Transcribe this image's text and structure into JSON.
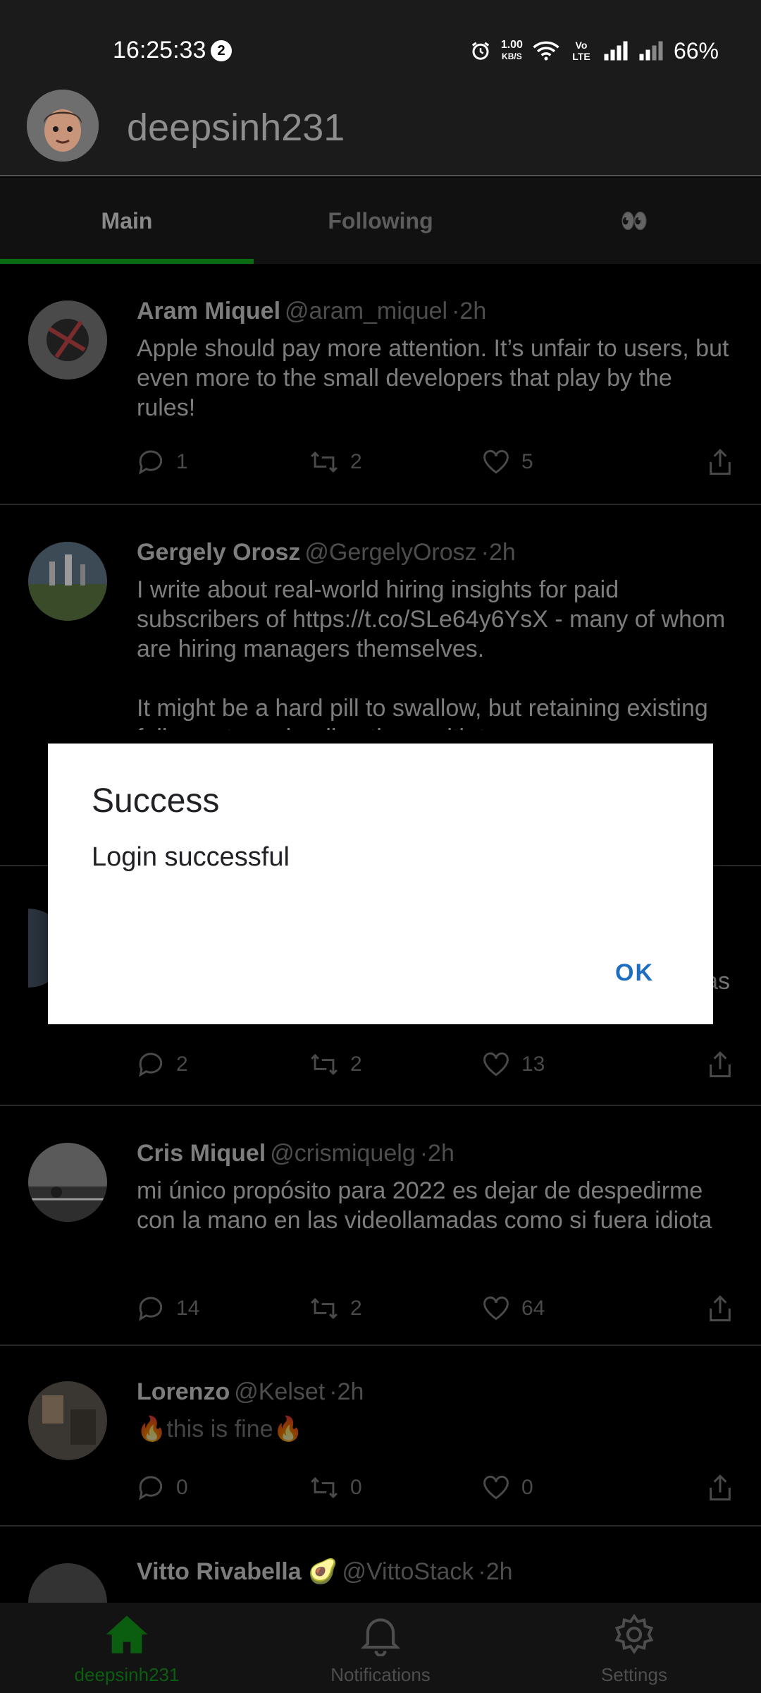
{
  "status_bar": {
    "time": "16:25:33",
    "notification_count": "2",
    "net_speed_value": "1.00",
    "net_speed_unit": "KB/S",
    "volte": "Vo LTE",
    "battery": "66%"
  },
  "header": {
    "username": "deepsinh231"
  },
  "tabs": [
    {
      "label": "Main",
      "active": true
    },
    {
      "label": "Following",
      "active": false
    },
    {
      "label": "👀",
      "active": false
    }
  ],
  "posts": [
    {
      "name": "Aram Miquel",
      "handle": "@aram_miquel",
      "time": "2h",
      "text": "Apple should pay more attention. It’s unfair to users, but even more to the small developers that play by the rules!",
      "replies": "1",
      "retweets": "2",
      "likes": "5"
    },
    {
      "name": "Gergely Orosz",
      "handle": "@GergelyOrosz",
      "time": "2h",
      "text": "I write about real-world hiring insights for paid subscribers of https://t.co/SLe64y6YsX - many of whom are hiring managers themselves.\n\nIt might be a hard pill to swallow, but retaining existing folks, not overloading them with too many",
      "replies": "",
      "retweets": "",
      "likes": ""
    },
    {
      "name": "",
      "handle": "",
      "time": "",
      "text": "as",
      "replies": "2",
      "retweets": "2",
      "likes": "13"
    },
    {
      "name": "Cris Miquel",
      "handle": "@crismiquelg",
      "time": "2h",
      "text": "mi único propósito para 2022 es dejar de despedirme con la mano en las videollamadas como si fuera idiota",
      "replies": "14",
      "retweets": "2",
      "likes": "64"
    },
    {
      "name": "Lorenzo",
      "handle": "@Kelset",
      "time": "2h",
      "text": "🔥this is fine🔥",
      "replies": "0",
      "retweets": "0",
      "likes": "0"
    },
    {
      "name": "Vitto Rivabella 🥑",
      "handle": "@VittoStack",
      "time": "2h",
      "text": "",
      "replies": "",
      "retweets": "",
      "likes": ""
    }
  ],
  "dialog": {
    "title": "Success",
    "message": "Login successful",
    "ok_label": "OK"
  },
  "bottom_nav": [
    {
      "label": "deepsinh231",
      "icon": "home-icon",
      "active": true
    },
    {
      "label": "Notifications",
      "icon": "bell-icon",
      "active": false
    },
    {
      "label": "Settings",
      "icon": "gear-icon",
      "active": false
    }
  ],
  "colors": {
    "accent_green": "#0b6b10",
    "dialog_button": "#1d6ec1"
  }
}
